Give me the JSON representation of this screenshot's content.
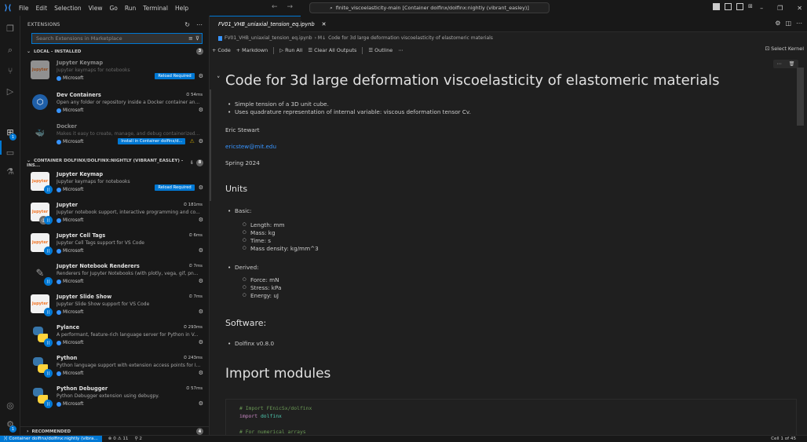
{
  "titlebar": {
    "menu": [
      "File",
      "Edit",
      "Selection",
      "View",
      "Go",
      "Run",
      "Terminal",
      "Help"
    ],
    "command_center": "finite_viscoelasticity-main [Container dolfinx/dolfinx:nightly (vibrant_easley)]"
  },
  "sidebar": {
    "title": "EXTENSIONS",
    "search_placeholder": "Search Extensions in Marketplace",
    "local_section": {
      "label": "LOCAL - INSTALLED",
      "count": "3"
    },
    "local_items": [
      {
        "name": "Jupyter Keymap",
        "desc": "Jupyter keymaps for notebooks",
        "publisher": "Microsoft",
        "time": "",
        "status": "Reload Required"
      },
      {
        "name": "Dev Containers",
        "desc": "Open any folder or repository inside a Docker container an...",
        "publisher": "Microsoft",
        "time": "54ms",
        "status": ""
      },
      {
        "name": "Docker",
        "desc": "Makes it easy to create, manage, and debug containerized ...",
        "publisher": "Microsoft",
        "time": "",
        "status": "Install in Container dolfinx/d..."
      }
    ],
    "container_section": {
      "label": "CONTAINER DOLFINX/DOLFINX:NIGHTLY (VIBRANT_EASLEY) - INS...",
      "count": "8"
    },
    "container_items": [
      {
        "name": "Jupyter Keymap",
        "desc": "Jupyter keymaps for notebooks",
        "publisher": "Microsoft",
        "time": "",
        "status": "Reload Required"
      },
      {
        "name": "Jupyter",
        "desc": "Jupyter notebook support, interactive programming and co...",
        "publisher": "Microsoft",
        "time": "181ms",
        "status": ""
      },
      {
        "name": "Jupyter Cell Tags",
        "desc": "Jupyter Cell Tags support for VS Code",
        "publisher": "Microsoft",
        "time": "6ms",
        "status": ""
      },
      {
        "name": "Jupyter Notebook Renderers",
        "desc": "Renderers for Jupyter Notebooks (with plotly, vega, gif, pn...",
        "publisher": "Microsoft",
        "time": "7ms",
        "status": ""
      },
      {
        "name": "Jupyter Slide Show",
        "desc": "Jupyter Slide Show support for VS Code",
        "publisher": "Microsoft",
        "time": "7ms",
        "status": ""
      },
      {
        "name": "Pylance",
        "desc": "A performant, feature-rich language server for Python in V...",
        "publisher": "Microsoft",
        "time": "293ms",
        "status": ""
      },
      {
        "name": "Python",
        "desc": "Python language support with extension access points for I...",
        "publisher": "Microsoft",
        "time": "243ms",
        "status": ""
      },
      {
        "name": "Python Debugger",
        "desc": "Python Debugger extension using debugpy.",
        "publisher": "Microsoft",
        "time": "57ms",
        "status": ""
      }
    ],
    "recommended_section": {
      "label": "RECOMMENDED",
      "count": "4"
    }
  },
  "editor": {
    "tab_label": "FV01_VHB_uniaxial_tension_eq.ipynb",
    "breadcrumb": [
      "FV01_VHB_uniaxial_tension_eq.ipynb",
      "Code for 3d large deformation viscoelasticity of elastomeric materials"
    ],
    "toolbar": {
      "code": "Code",
      "markdown": "Markdown",
      "run_all": "Run All",
      "clear_outputs": "Clear All Outputs",
      "outline": "Outline",
      "select_kernel": "Select Kernel"
    },
    "title": "Code for 3d large deformation viscoelasticity of elastomeric materials",
    "intro_bullets": [
      "Simple tension of a 3D unit cube.",
      "Uses quadrature representation of internal variable: viscous deformation tensor Cv."
    ],
    "author": "Eric Stewart",
    "email": "ericstew@mit.edu",
    "date": "Spring 2024",
    "units_heading": "Units",
    "basic_label": "Basic:",
    "basic_items": [
      "Length: mm",
      "Mass: kg",
      "Time: s",
      "Mass density: kg/mm^3"
    ],
    "derived_label": "Derived:",
    "derived_items": [
      "Force: mN",
      "Stress: kPa",
      "Energy: uJ"
    ],
    "software_heading": "Software:",
    "software_items": [
      "Dolfinx v0.8.0"
    ],
    "import_heading": "Import modules",
    "code_lines": [
      {
        "text": "# Import FEnicSx/dolfinx",
        "kind": "comment"
      },
      {
        "text": "import dolfinx",
        "kind": "import"
      },
      {
        "text": "",
        "kind": "blank"
      },
      {
        "text": "# For numerical arrays",
        "kind": "comment"
      }
    ]
  },
  "statusbar": {
    "remote": "Container dolfinx/dolfinx:nightly (vibra...",
    "problems": "⊗ 0 ⚠ 11",
    "ports": "⚲ 2",
    "cell_position": "Cell 1 of 45"
  },
  "colors": {
    "accent": "#0078d4",
    "link": "#3794ff",
    "background": "#1f1f1f",
    "sidebar": "#181818"
  }
}
